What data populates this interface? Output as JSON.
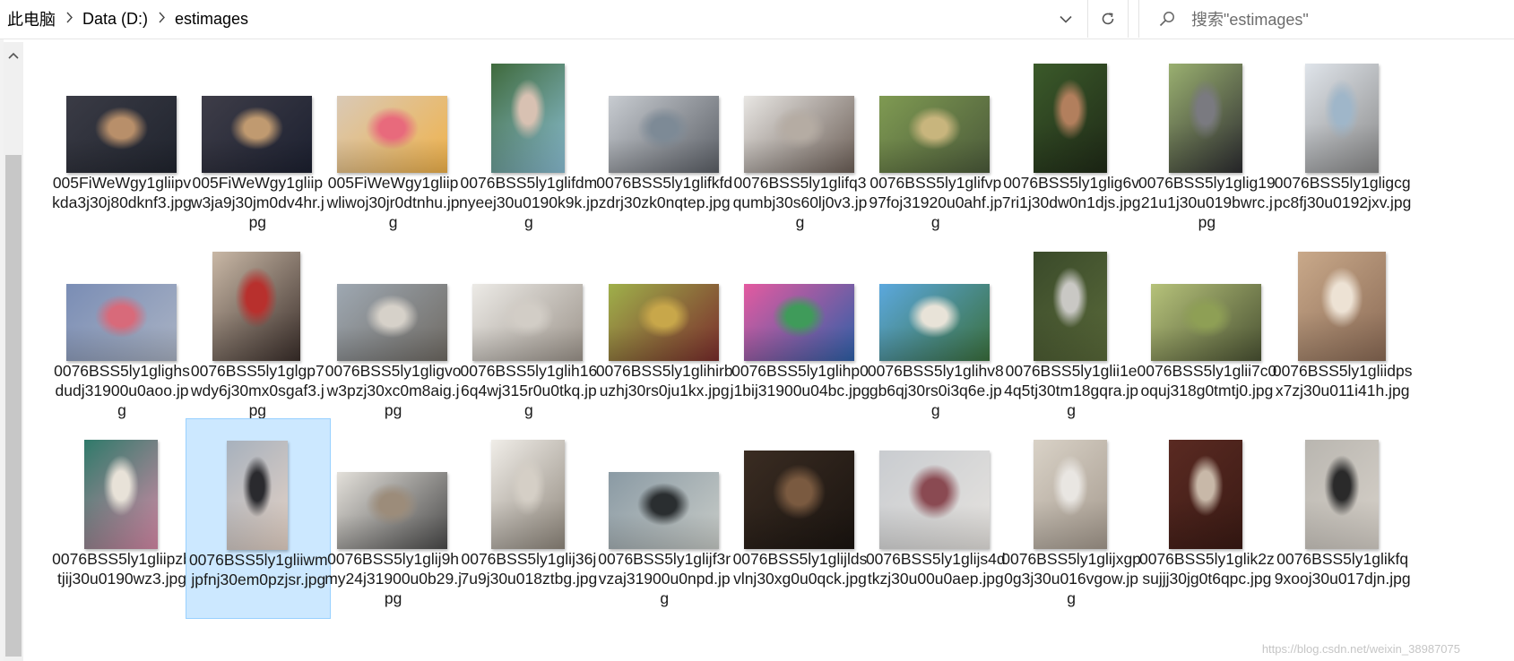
{
  "address_bar": {
    "crumbs": [
      "此电脑",
      "Data (D:)",
      "estimages"
    ]
  },
  "search": {
    "placeholder": "搜索\"estimages\""
  },
  "icons": {
    "separator": "chevron-right-icon",
    "dropdown": "chevron-down-icon",
    "refresh": "refresh-icon",
    "search": "search-icon",
    "scroll_up": "scroll-up-arrow-icon"
  },
  "colors": {
    "selection_bg": "#cce8ff",
    "selection_border": "#99d1ff"
  },
  "selected_index": 21,
  "files": [
    {
      "name": "005FiWeWgy1gliipvkda3j30j80dknf3.jpg",
      "orient": "landscape",
      "colors": [
        "#3a3b45",
        "#b88f6a",
        "#20242e"
      ]
    },
    {
      "name": "005FiWeWgy1gliipw3ja9j30jm0dv4hr.jpg",
      "orient": "landscape",
      "colors": [
        "#3e3d48",
        "#c09a70",
        "#1c2030"
      ]
    },
    {
      "name": "005FiWeWgy1gliipwliwoj30jr0dtnhu.jpg",
      "orient": "landscape",
      "colors": [
        "#d9c9b6",
        "#e86a7c",
        "#f0b24a"
      ]
    },
    {
      "name": "0076BSS5ly1glifdmnyeej30u0190k9k.jpg",
      "orient": "portrait",
      "colors": [
        "#3f6a3c",
        "#d8c1b2",
        "#8cc0d6"
      ]
    },
    {
      "name": "0076BSS5ly1glifkfdzdrj30zk0nqtep.jpg",
      "orient": "landscape",
      "colors": [
        "#c8ccd1",
        "#7d8a96",
        "#5b5f66"
      ]
    },
    {
      "name": "0076BSS5ly1glifq3qumbj30s60lj0v3.jpg",
      "orient": "landscape",
      "colors": [
        "#e8e6e3",
        "#b5aca3",
        "#6c5f57"
      ]
    },
    {
      "name": "0076BSS5ly1glifvp97foj31920u0ahf.jpg",
      "orient": "landscape",
      "colors": [
        "#7f9a52",
        "#c8b57d",
        "#4b5a3a"
      ]
    },
    {
      "name": "0076BSS5ly1glig6v7ri1j30dw0n1djs.jpg",
      "orient": "portrait",
      "colors": [
        "#3b5a2a",
        "#b27f5d",
        "#1f2a17"
      ]
    },
    {
      "name": "0076BSS5ly1glig1921u1j30u019bwrc.jpg",
      "orient": "portrait",
      "colors": [
        "#9ab070",
        "#7a7a80",
        "#2c2c30"
      ]
    },
    {
      "name": "0076BSS5ly1gligcgpc8fj30u0192jxv.jpg",
      "orient": "portrait",
      "colors": [
        "#dfe4ea",
        "#9fb6c9",
        "#8a8a8a"
      ]
    },
    {
      "name": "0076BSS5ly1glighsdudj31900u0aoo.jpg",
      "orient": "landscape",
      "colors": [
        "#7a8db5",
        "#d86a7a",
        "#aab3c4"
      ]
    },
    {
      "name": "0076BSS5ly1glgp7wdy6j30mx0sgaf3.jpg",
      "orient": "portrait-wide",
      "colors": [
        "#c9b8a6",
        "#b8302d",
        "#3a2e2a"
      ]
    },
    {
      "name": "0076BSS5ly1gligvow3pzj30xc0m8aig.jpg",
      "orient": "landscape",
      "colors": [
        "#9ea8b2",
        "#d6d1c9",
        "#6f6a63"
      ]
    },
    {
      "name": "0076BSS5ly1glih166q4wj315r0u0tkq.jpg",
      "orient": "landscape",
      "colors": [
        "#eceae6",
        "#d2cdc6",
        "#9c948b"
      ]
    },
    {
      "name": "0076BSS5ly1glihirbuzhj30rs0ju1kx.jpg",
      "orient": "landscape",
      "colors": [
        "#9fb04a",
        "#c8a74a",
        "#7a2c2c"
      ]
    },
    {
      "name": "0076BSS5ly1glihp0j1bij31900u04bc.jpg",
      "orient": "landscape",
      "colors": [
        "#e45aa0",
        "#3f9b5a",
        "#2d60a8"
      ]
    },
    {
      "name": "0076BSS5ly1glihv8gb6qj30rs0i3q6e.jpg",
      "orient": "landscape",
      "colors": [
        "#5ba8de",
        "#e8e3d8",
        "#3a6f3c"
      ]
    },
    {
      "name": "0076BSS5ly1glii1e4q5tj30tm18gqra.jpg",
      "orient": "portrait",
      "colors": [
        "#3a4a2a",
        "#c9c8c4",
        "#5a6a3a"
      ]
    },
    {
      "name": "0076BSS5ly1glii7c0oquj318g0tmtj0.jpg",
      "orient": "landscape",
      "colors": [
        "#b6c27a",
        "#8e9f55",
        "#4a5233"
      ]
    },
    {
      "name": "0076BSS5ly1gliidpsx7zj30u011i41h.jpg",
      "orient": "portrait-wide",
      "colors": [
        "#c9a98a",
        "#ede2d4",
        "#8a6a55"
      ]
    },
    {
      "name": "0076BSS5ly1gliipzbtjij30u0190wz3.jpg",
      "orient": "portrait",
      "colors": [
        "#2f7a6a",
        "#e8e2d8",
        "#d88aa8"
      ]
    },
    {
      "name": "0076BSS5ly1gliiwmjpfnj30em0pzjsr.jpg",
      "orient": "portrait-narrow",
      "colors": [
        "#a7b1bd",
        "#2a2a2e",
        "#e6d3c6"
      ]
    },
    {
      "name": "0076BSS5ly1glij9hmy24j31900u0b29.jpg",
      "orient": "landscape",
      "colors": [
        "#e3e0da",
        "#9c8c7a",
        "#4a4a4a"
      ]
    },
    {
      "name": "0076BSS5ly1glij36j7u9j30u018ztbg.jpg",
      "orient": "portrait",
      "colors": [
        "#f0ede8",
        "#d5cfc6",
        "#8f877c"
      ]
    },
    {
      "name": "0076BSS5ly1glijf3rvzaj31900u0npd.jpg",
      "orient": "landscape",
      "colors": [
        "#8a9aa4",
        "#2a2e30",
        "#c8ccc8"
      ]
    },
    {
      "name": "0076BSS5ly1glijldsvlnj30xg0u0qck.jpg",
      "orient": "landscape-tall",
      "colors": [
        "#3a2c22",
        "#7a5a40",
        "#1a1410"
      ]
    },
    {
      "name": "0076BSS5ly1glijs4dtkzj30u00u0aep.jpg",
      "orient": "landscape-tall",
      "colors": [
        "#c9ccd0",
        "#8a4a52",
        "#e6e3df"
      ]
    },
    {
      "name": "0076BSS5ly1glijxgp0g3j30u016vgow.jpg",
      "orient": "portrait",
      "colors": [
        "#d9d2c7",
        "#e9e6e2",
        "#a59a8e"
      ]
    },
    {
      "name": "0076BSS5ly1glik2zsujjj30jg0t6qpc.jpg",
      "orient": "portrait",
      "colors": [
        "#5a2a22",
        "#c8b8a8",
        "#3a1a14"
      ]
    },
    {
      "name": "0076BSS5ly1glikfq9xooj30u017djn.jpg",
      "orient": "portrait",
      "colors": [
        "#b9b6b0",
        "#2a2a2a",
        "#d8d2ca"
      ]
    }
  ],
  "watermark_text": "https://blog.csdn.net/weixin_38987075"
}
